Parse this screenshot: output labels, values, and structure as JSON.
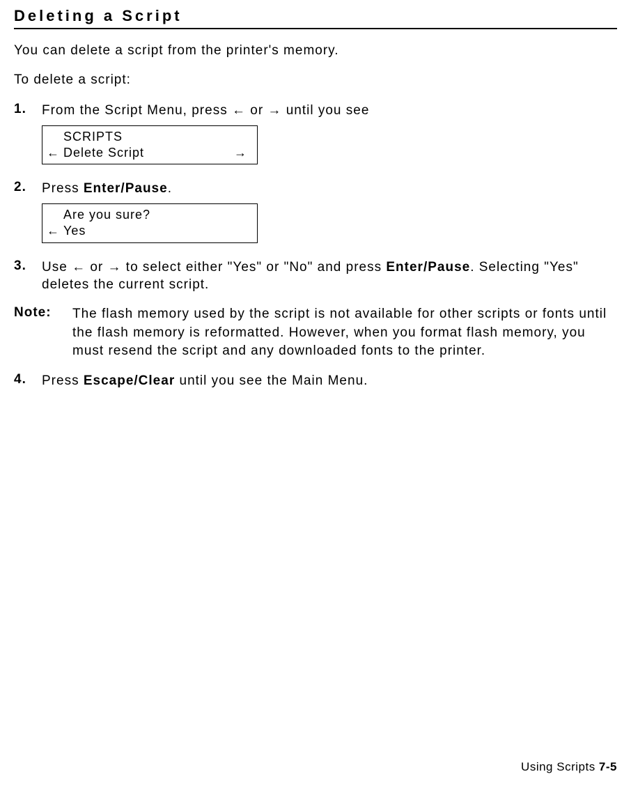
{
  "heading": "Deleting a Script",
  "intro": "You can delete a script from the printer's memory.",
  "subintro": "To delete a script:",
  "arrows": {
    "left": "←",
    "right": "→"
  },
  "steps": [
    {
      "number": "1.",
      "text_before": "From the Script Menu, press ",
      "text_mid": " or ",
      "text_after": " until you see",
      "display": {
        "line1": "SCRIPTS",
        "line2": "Delete Script",
        "showLeft": true,
        "showRight": true
      }
    },
    {
      "number": "2.",
      "text_before": "Press ",
      "bold_text": "Enter/Pause",
      "text_after": ".",
      "display": {
        "line1": "Are you sure?",
        "line2": "Yes",
        "showLeft": true,
        "showRight": false
      }
    },
    {
      "number": "3.",
      "text_before": "Use ",
      "text_mid": " or ",
      "text_after": " to select either \"Yes\" or \"No\" and press ",
      "bold_text": "Enter/Pause",
      "text_end": ". Selecting \"Yes\" deletes the current script."
    },
    {
      "number": "4.",
      "text_before": "Press ",
      "bold_text": "Escape/Clear",
      "text_after": " until you see the Main Menu."
    }
  ],
  "note": {
    "label": "Note:",
    "content": "The flash memory used by the script is not available for other scripts or fonts until the flash memory is reformatted.  However, when you format flash memory, you must resend the script and any downloaded fonts to the printer."
  },
  "footer": {
    "text": "Using Scripts  ",
    "page": "7-5"
  }
}
